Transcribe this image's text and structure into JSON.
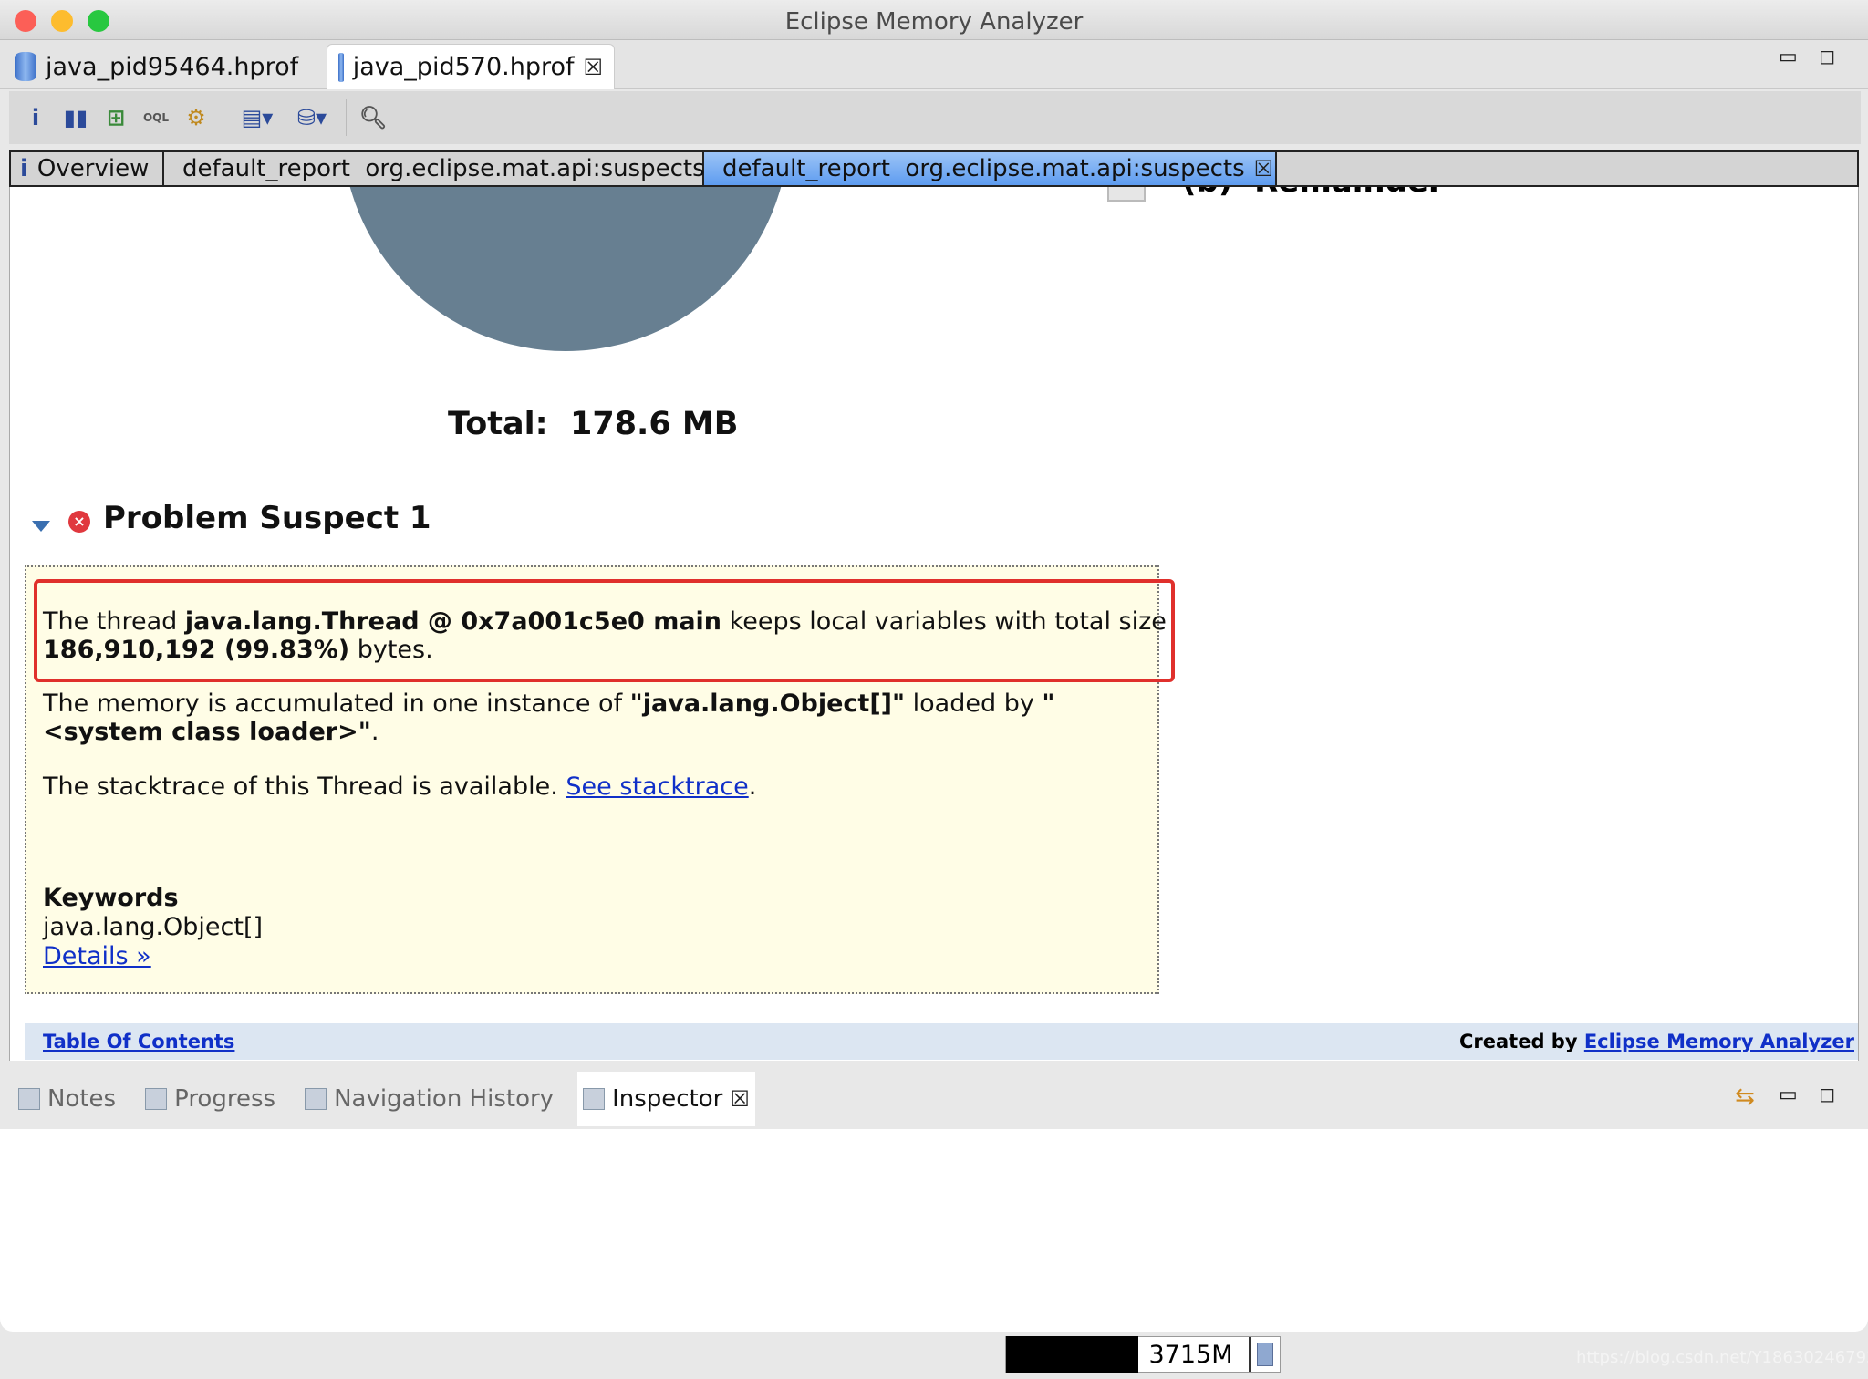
{
  "window": {
    "title": "Eclipse Memory Analyzer"
  },
  "editor_tabs": [
    {
      "label": "java_pid95464.hprof",
      "active": false
    },
    {
      "label": "java_pid570.hprof",
      "active": true,
      "closable": true
    }
  ],
  "toolbar": {
    "icons": [
      "info-icon",
      "histogram-icon",
      "dominator-tree-icon",
      "oql-icon",
      "heap-dump-details-icon",
      "query-browser-icon",
      "run-report-icon",
      "search-icon"
    ]
  },
  "inner_tabs": [
    {
      "label": "Overview"
    },
    {
      "label": "default_report  org.eclipse.mat.api:suspects"
    },
    {
      "label": "default_report  org.eclipse.mat.api:suspects",
      "active": true
    }
  ],
  "report": {
    "legend_partial": "(b)  Remainder",
    "pie_color": "#677f91",
    "total": "Total:  178.6 MB",
    "suspect_title": "Problem Suspect 1",
    "line1_a": "The thread ",
    "line1_b": "java.lang.Thread @ 0x7a001c5e0 main",
    "line1_c": " keeps local variables with total size",
    "line2_b": "186,910,192 (99.83%)",
    "line2_c": " bytes.",
    "line3_a": "The memory is accumulated in one instance of ",
    "line3_b": "\"java.lang.Object[]\"",
    "line3_c": " loaded by ",
    "line3_d": "\"",
    "line4_b": "<system class loader>\"",
    "line4_c": ".",
    "line5_a": "The stacktrace of this Thread is available. ",
    "line5_link": "See stacktrace",
    "line5_c": ".",
    "keywords_label": "Keywords",
    "keyword": "java.lang.Object[]",
    "details_link": "Details »",
    "toc_link": "Table Of Contents",
    "created_by": "Created by ",
    "created_link": "Eclipse Memory Analyzer"
  },
  "bottom_tabs": [
    {
      "label": "Notes"
    },
    {
      "label": "Progress"
    },
    {
      "label": "Navigation History"
    },
    {
      "label": "Inspector",
      "active": true
    }
  ],
  "status": {
    "heap": "3715M"
  },
  "watermark": "https://blog.csdn.net/Y18630246793194530",
  "colors": {
    "highlight": "#e0302c",
    "active_tab": "#5e9cf0",
    "report_box": "#fffde6",
    "link": "#1030c8"
  }
}
